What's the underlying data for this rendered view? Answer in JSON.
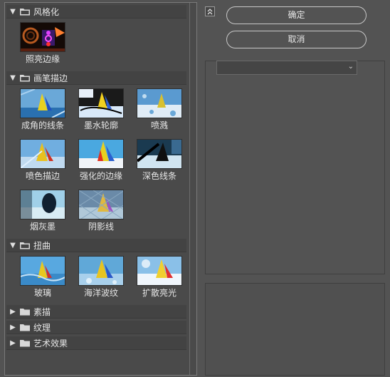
{
  "buttons": {
    "ok": "确定",
    "cancel": "取消"
  },
  "selector": {
    "value": ""
  },
  "categories": [
    {
      "label": "风格化",
      "expanded": true,
      "items": [
        "照亮边缘"
      ]
    },
    {
      "label": "画笔描边",
      "expanded": true,
      "items": [
        "成角的线条",
        "墨水轮廓",
        "喷溅",
        "喷色描边",
        "强化的边缘",
        "深色线条",
        "烟灰墨",
        "阴影线"
      ]
    },
    {
      "label": "扭曲",
      "expanded": true,
      "items": [
        "玻璃",
        "海洋波纹",
        "扩散亮光"
      ]
    },
    {
      "label": "素描",
      "expanded": false,
      "items": []
    },
    {
      "label": "纹理",
      "expanded": false,
      "items": []
    },
    {
      "label": "艺术效果",
      "expanded": false,
      "items": []
    }
  ]
}
